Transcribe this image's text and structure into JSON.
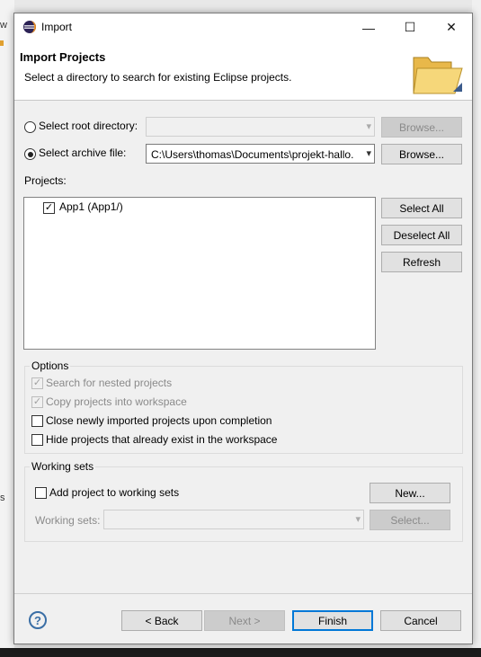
{
  "background": {
    "left_text_1": "w",
    "left_text_2": "s"
  },
  "window": {
    "title": "Import",
    "min_glyph": "—",
    "max_glyph": "☐",
    "close_glyph": "✕"
  },
  "header": {
    "title": "Import Projects",
    "description": "Select a directory to search for existing Eclipse projects."
  },
  "source": {
    "root_dir_label": "Select root directory:",
    "root_dir_value": "",
    "root_browse_label": "Browse...",
    "archive_label": "Select archive file:",
    "archive_value": "C:\\Users\\thomas\\Documents\\projekt-hallo.",
    "archive_browse_label": "Browse...",
    "selected": "archive"
  },
  "projects": {
    "label": "Projects:",
    "items": [
      {
        "label": "App1 (App1/)",
        "checked": true
      }
    ],
    "select_all_label": "Select All",
    "deselect_all_label": "Deselect All",
    "refresh_label": "Refresh"
  },
  "options": {
    "title": "Options",
    "items": [
      {
        "label": "Search for nested projects",
        "checked": true,
        "enabled": false
      },
      {
        "label": "Copy projects into workspace",
        "checked": true,
        "enabled": false
      },
      {
        "label": "Close newly imported projects upon completion",
        "checked": false,
        "enabled": true
      },
      {
        "label": "Hide projects that already exist in the workspace",
        "checked": false,
        "enabled": true
      }
    ]
  },
  "working_sets": {
    "title": "Working sets",
    "add_label": "Add project to working sets",
    "new_label": "New...",
    "sets_label": "Working sets:",
    "sets_value": "",
    "select_label": "Select..."
  },
  "footer": {
    "help_glyph": "?",
    "back_label": "< Back",
    "next_label": "Next >",
    "finish_label": "Finish",
    "cancel_label": "Cancel"
  },
  "colors": {
    "accent": "#0078d7",
    "dialog_bg": "#f0f0f0",
    "header_bg": "#ffffff"
  }
}
